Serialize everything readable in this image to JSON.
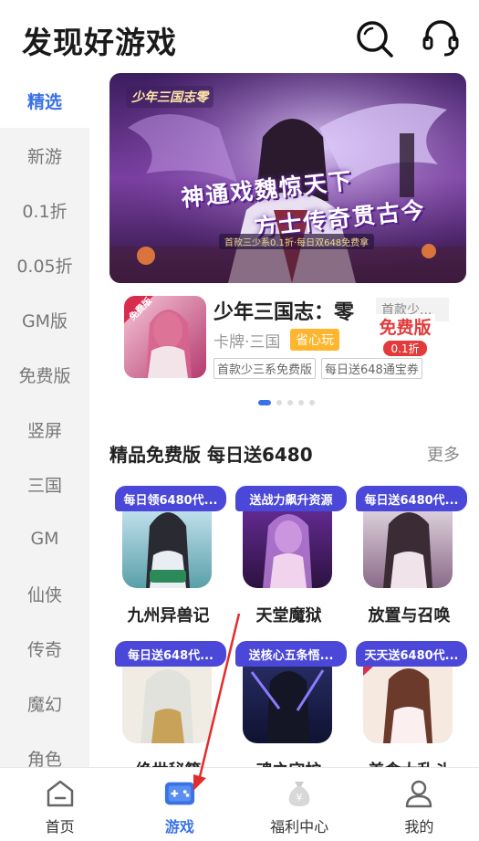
{
  "header": {
    "title": "发现好游戏",
    "search_icon": "search-icon",
    "service_icon": "headset-icon"
  },
  "sidebar": {
    "items": [
      {
        "label": "精选",
        "active": true
      },
      {
        "label": "新游"
      },
      {
        "label": "0.1折"
      },
      {
        "label": "0.05折"
      },
      {
        "label": "GM版"
      },
      {
        "label": "免费版"
      },
      {
        "label": "竖屏"
      },
      {
        "label": "三国"
      },
      {
        "label": "GM"
      },
      {
        "label": "仙侠"
      },
      {
        "label": "传奇"
      },
      {
        "label": "魔幻"
      },
      {
        "label": "角色"
      }
    ]
  },
  "banner": {
    "logo": "少年三国志零",
    "headline1": "神通戏魏惊天下",
    "headline2": "方士传奇贯古今",
    "subline": "首款三少系0.1折·每日双648免费拿"
  },
  "featured": {
    "name": "少年三国志：零",
    "inline_tag": "首款少...",
    "category": "卡牌·三国",
    "badge": "省心玩",
    "tags": [
      "首款少三系免费版",
      "每日送648通宝券"
    ],
    "seal_main": "免费版",
    "seal_sub": "0.1折",
    "icon_corner": "免费版"
  },
  "carousel": {
    "count": 5,
    "active_index": 0
  },
  "section": {
    "title": "精品免费版 每日送6480",
    "more": "更多"
  },
  "games": [
    {
      "tag": "每日领6480代...",
      "name": "九州异兽记"
    },
    {
      "tag": "送战力飙升资源",
      "name": "天堂魔狱"
    },
    {
      "tag": "每日送6480代...",
      "name": "放置与召唤"
    },
    {
      "tag": "每日送648代...",
      "name": "绝世秘籍"
    },
    {
      "tag": "送核心五条悟...",
      "name": "魂之守护"
    },
    {
      "tag": "天天送6480代...",
      "name": "美食大乱斗"
    }
  ],
  "bottom_nav": {
    "items": [
      {
        "label": "首页",
        "icon": "home-icon"
      },
      {
        "label": "游戏",
        "icon": "gamepad-icon",
        "active": true
      },
      {
        "label": "福利中心",
        "icon": "money-bag-icon"
      },
      {
        "label": "我的",
        "icon": "user-icon"
      }
    ]
  },
  "colors": {
    "accent": "#3a72e6",
    "tag_purple": "#4a47d9",
    "badge_orange": "#ffb62e",
    "annotation_red": "#e32b2b"
  }
}
